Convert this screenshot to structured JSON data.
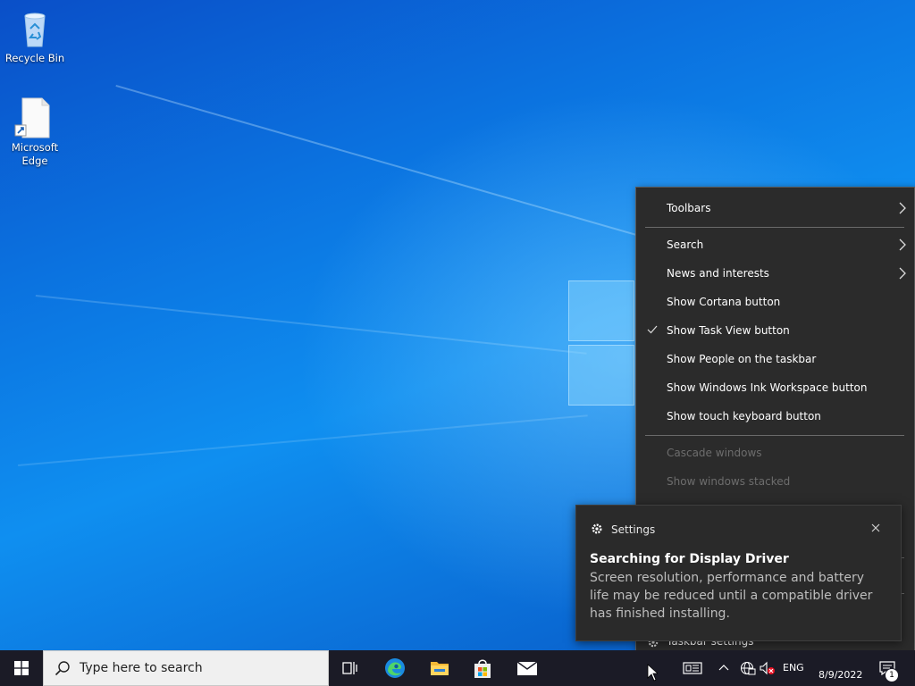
{
  "desktop": {
    "icons": [
      {
        "label": "Recycle Bin"
      },
      {
        "label": "Microsoft Edge"
      }
    ]
  },
  "context_menu": {
    "items": [
      {
        "label": "Toolbars",
        "submenu": true,
        "checked": false,
        "enabled": true
      },
      {
        "label": "Search",
        "submenu": true,
        "checked": false,
        "enabled": true
      },
      {
        "label": "News and interests",
        "submenu": true,
        "checked": false,
        "enabled": true
      },
      {
        "label": "Show Cortana button",
        "submenu": false,
        "checked": false,
        "enabled": true
      },
      {
        "label": "Show Task View button",
        "submenu": false,
        "checked": true,
        "enabled": true
      },
      {
        "label": "Show People on the taskbar",
        "submenu": false,
        "checked": false,
        "enabled": true
      },
      {
        "label": "Show Windows Ink Workspace button",
        "submenu": false,
        "checked": false,
        "enabled": true
      },
      {
        "label": "Show touch keyboard button",
        "submenu": false,
        "checked": false,
        "enabled": true
      },
      {
        "label": "Cascade windows",
        "submenu": false,
        "checked": false,
        "enabled": false
      },
      {
        "label": "Show windows stacked",
        "submenu": false,
        "checked": false,
        "enabled": false
      },
      {
        "label": "Taskbar settings",
        "submenu": false,
        "checked": false,
        "enabled": true
      }
    ]
  },
  "toast": {
    "app_name": "Settings",
    "title": "Searching for Display Driver",
    "body": "Screen resolution, performance and battery life may be reduced until a compatible driver has finished installing."
  },
  "taskbar": {
    "search_placeholder": "Type here to search",
    "pinned": [
      "task-view",
      "microsoft-edge",
      "file-explorer",
      "microsoft-store",
      "mail"
    ],
    "tray": {
      "language": "ENG",
      "date": "8/9/2022",
      "notification_count": "1"
    }
  },
  "colors": {
    "menu_bg": "#2b2b2b",
    "toast_bg": "#2a2a2a",
    "taskbar_bg": "#1b1b26",
    "desktop_blue": "#0b73e0"
  }
}
